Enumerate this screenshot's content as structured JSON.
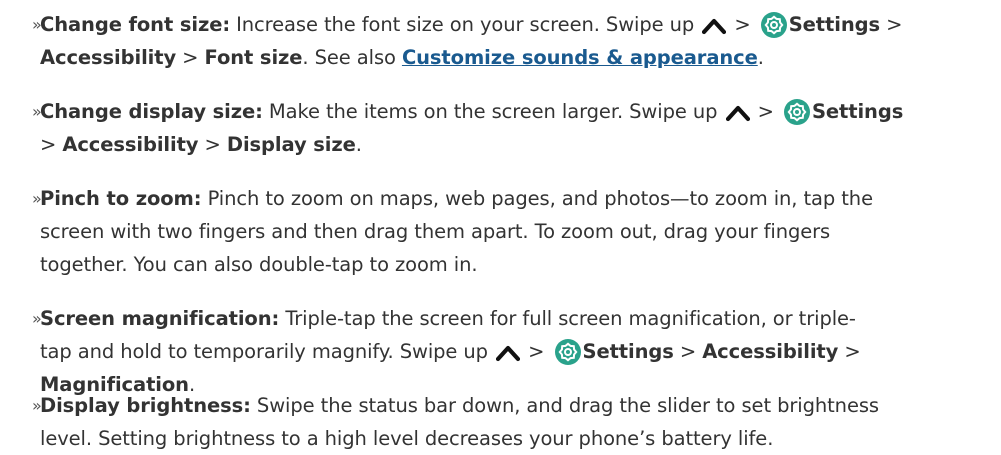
{
  "bullets": [
    {
      "lines": [
        [
          {
            "t": "b",
            "v": "Change font size:"
          },
          {
            "t": "s",
            "v": " Increase the font size on your screen. Swipe up "
          },
          {
            "t": "caret"
          },
          {
            "t": "s",
            "v": " > "
          },
          {
            "t": "gear"
          },
          {
            "t": "b",
            "v": "Settings"
          },
          {
            "t": "s",
            "v": " >"
          }
        ],
        [
          {
            "t": "b",
            "v": "Accessibility"
          },
          {
            "t": "s",
            "v": " > "
          },
          {
            "t": "b",
            "v": "Font size"
          },
          {
            "t": "s",
            "v": ". See also "
          },
          {
            "t": "link",
            "v": "Customize sounds & appearance"
          },
          {
            "t": "s",
            "v": "."
          }
        ]
      ]
    },
    {
      "lines": [
        [
          {
            "t": "b",
            "v": "Change display size:"
          },
          {
            "t": "s",
            "v": " Make the items on the screen larger. Swipe up "
          },
          {
            "t": "caret"
          },
          {
            "t": "s",
            "v": " > "
          },
          {
            "t": "gear"
          },
          {
            "t": "b",
            "v": "Settings"
          }
        ],
        [
          {
            "t": "s",
            "v": "> "
          },
          {
            "t": "b",
            "v": "Accessibility"
          },
          {
            "t": "s",
            "v": " > "
          },
          {
            "t": "b",
            "v": "Display size"
          },
          {
            "t": "s",
            "v": "."
          }
        ]
      ]
    },
    {
      "lines": [
        [
          {
            "t": "b",
            "v": "Pinch to zoom:"
          },
          {
            "t": "s",
            "v": " Pinch to zoom on maps, web pages, and photos—to zoom in, tap the"
          }
        ],
        [
          {
            "t": "s",
            "v": "screen with two fingers and then drag them apart. To zoom out, drag your fingers"
          }
        ],
        [
          {
            "t": "s",
            "v": "together. You can also double-tap to zoom in."
          }
        ]
      ]
    },
    {
      "lines": [
        [
          {
            "t": "b",
            "v": "Screen magnification:"
          },
          {
            "t": "s",
            "v": " Triple-tap the screen for full screen magnification, or triple-"
          }
        ],
        [
          {
            "t": "s",
            "v": "tap and hold to temporarily magnify. Swipe up "
          },
          {
            "t": "caret"
          },
          {
            "t": "s",
            "v": " > "
          },
          {
            "t": "gear"
          },
          {
            "t": "b",
            "v": "Settings"
          },
          {
            "t": "s",
            "v": " > "
          },
          {
            "t": "b",
            "v": "Accessibility"
          },
          {
            "t": "s",
            "v": " >"
          }
        ],
        [
          {
            "t": "b",
            "v": "Magnification"
          },
          {
            "t": "s",
            "v": "."
          }
        ]
      ]
    },
    {
      "lines": [
        [
          {
            "t": "b",
            "v": "Display brightness:"
          },
          {
            "t": "s",
            "v": " Swipe the status bar down, and drag the slider to set brightness"
          }
        ],
        [
          {
            "t": "s",
            "v": "level. Setting brightness to a high level decreases your phone’s battery life."
          }
        ]
      ]
    }
  ],
  "bullet_marker": "»",
  "colors": {
    "text": "#333333",
    "link": "#1a5a8f",
    "icon": "#2aa28b"
  },
  "icons": {
    "caret": "chevron-up-icon",
    "gear": "settings-gear-icon"
  }
}
